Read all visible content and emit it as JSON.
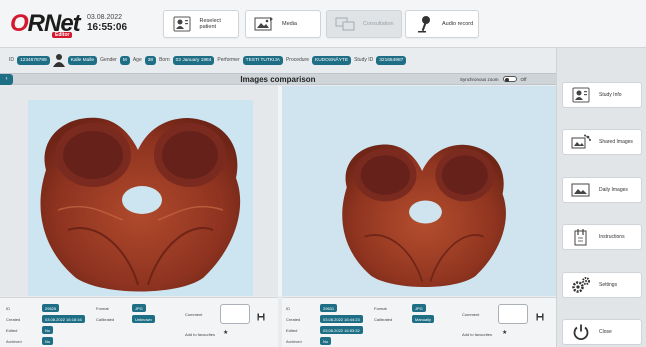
{
  "header": {
    "logo_first": "O",
    "logo_rest": "RNet",
    "logo_sub": "Editor",
    "date": "03.08.2022",
    "time": "16:55:06",
    "buttons": [
      {
        "label": "Reselect patient",
        "icon": "patient-card-icon",
        "state": "enabled"
      },
      {
        "label": "Media",
        "icon": "media-icon",
        "state": "enabled"
      },
      {
        "label": "Consultation",
        "icon": "consultation-icon",
        "state": "disabled"
      },
      {
        "label": "Audio record",
        "icon": "microphone-icon",
        "state": "enabled"
      }
    ]
  },
  "patient": {
    "id_label": "ID",
    "id_value": "1234678789",
    "name": "Kalle Malle",
    "gender_label": "Gender",
    "gender": "M",
    "age_label": "Age",
    "age": "38",
    "born_label": "Born",
    "born": "02 January 1984",
    "performer_label": "Performer",
    "performer": "TESTI TUTKIJA",
    "procedure_label": "Procedure",
    "procedure": "KUDOSNÄYTE",
    "study_label": "Study ID",
    "study_id": "321654987"
  },
  "title_bar": {
    "title": "Images comparison",
    "collapse_glyph": "‹",
    "sync_label": "Synchronous zoom",
    "sync_state": "Off"
  },
  "left_meta": {
    "id_label": "ID",
    "id": "29625",
    "created_label": "Created",
    "created": "03.08.2022 16:18:16",
    "edited_label": "Edited",
    "edited": "No",
    "archived_label": "Archived",
    "archived": "No",
    "format_label": "Format",
    "format": "JPG",
    "calibrated_label": "Calibrated",
    "calibrated": "Unknown",
    "comment_label": "Comment",
    "favourites_label": "Add to favourites"
  },
  "right_meta": {
    "id_label": "ID",
    "id": "29631",
    "created_label": "Created",
    "created": "03.08.2022 16:44:23",
    "edited_label": "Edited",
    "edited": "03.08.2022 16:53:32",
    "archived_label": "Archived",
    "archived": "No",
    "format_label": "Format",
    "format": "JPG",
    "calibrated_label": "Calibrated",
    "calibrated": "Manually",
    "comment_label": "Comment",
    "favourites_label": "Add to favourites"
  },
  "sidebar": {
    "items": [
      {
        "label": "Study Info",
        "icon": "study-info-icon"
      },
      {
        "label": "Shared Images",
        "icon": "shared-images-icon"
      },
      {
        "label": "Daily Images",
        "icon": "daily-images-icon"
      },
      {
        "label": "Instructions",
        "icon": "instructions-icon"
      },
      {
        "label": "Settings",
        "icon": "settings-icon"
      },
      {
        "label": "Close",
        "icon": "power-icon"
      }
    ]
  },
  "colors": {
    "accent": "#1e6f86",
    "brand_red": "#d4182d",
    "image_bg": "#cde5f0"
  }
}
